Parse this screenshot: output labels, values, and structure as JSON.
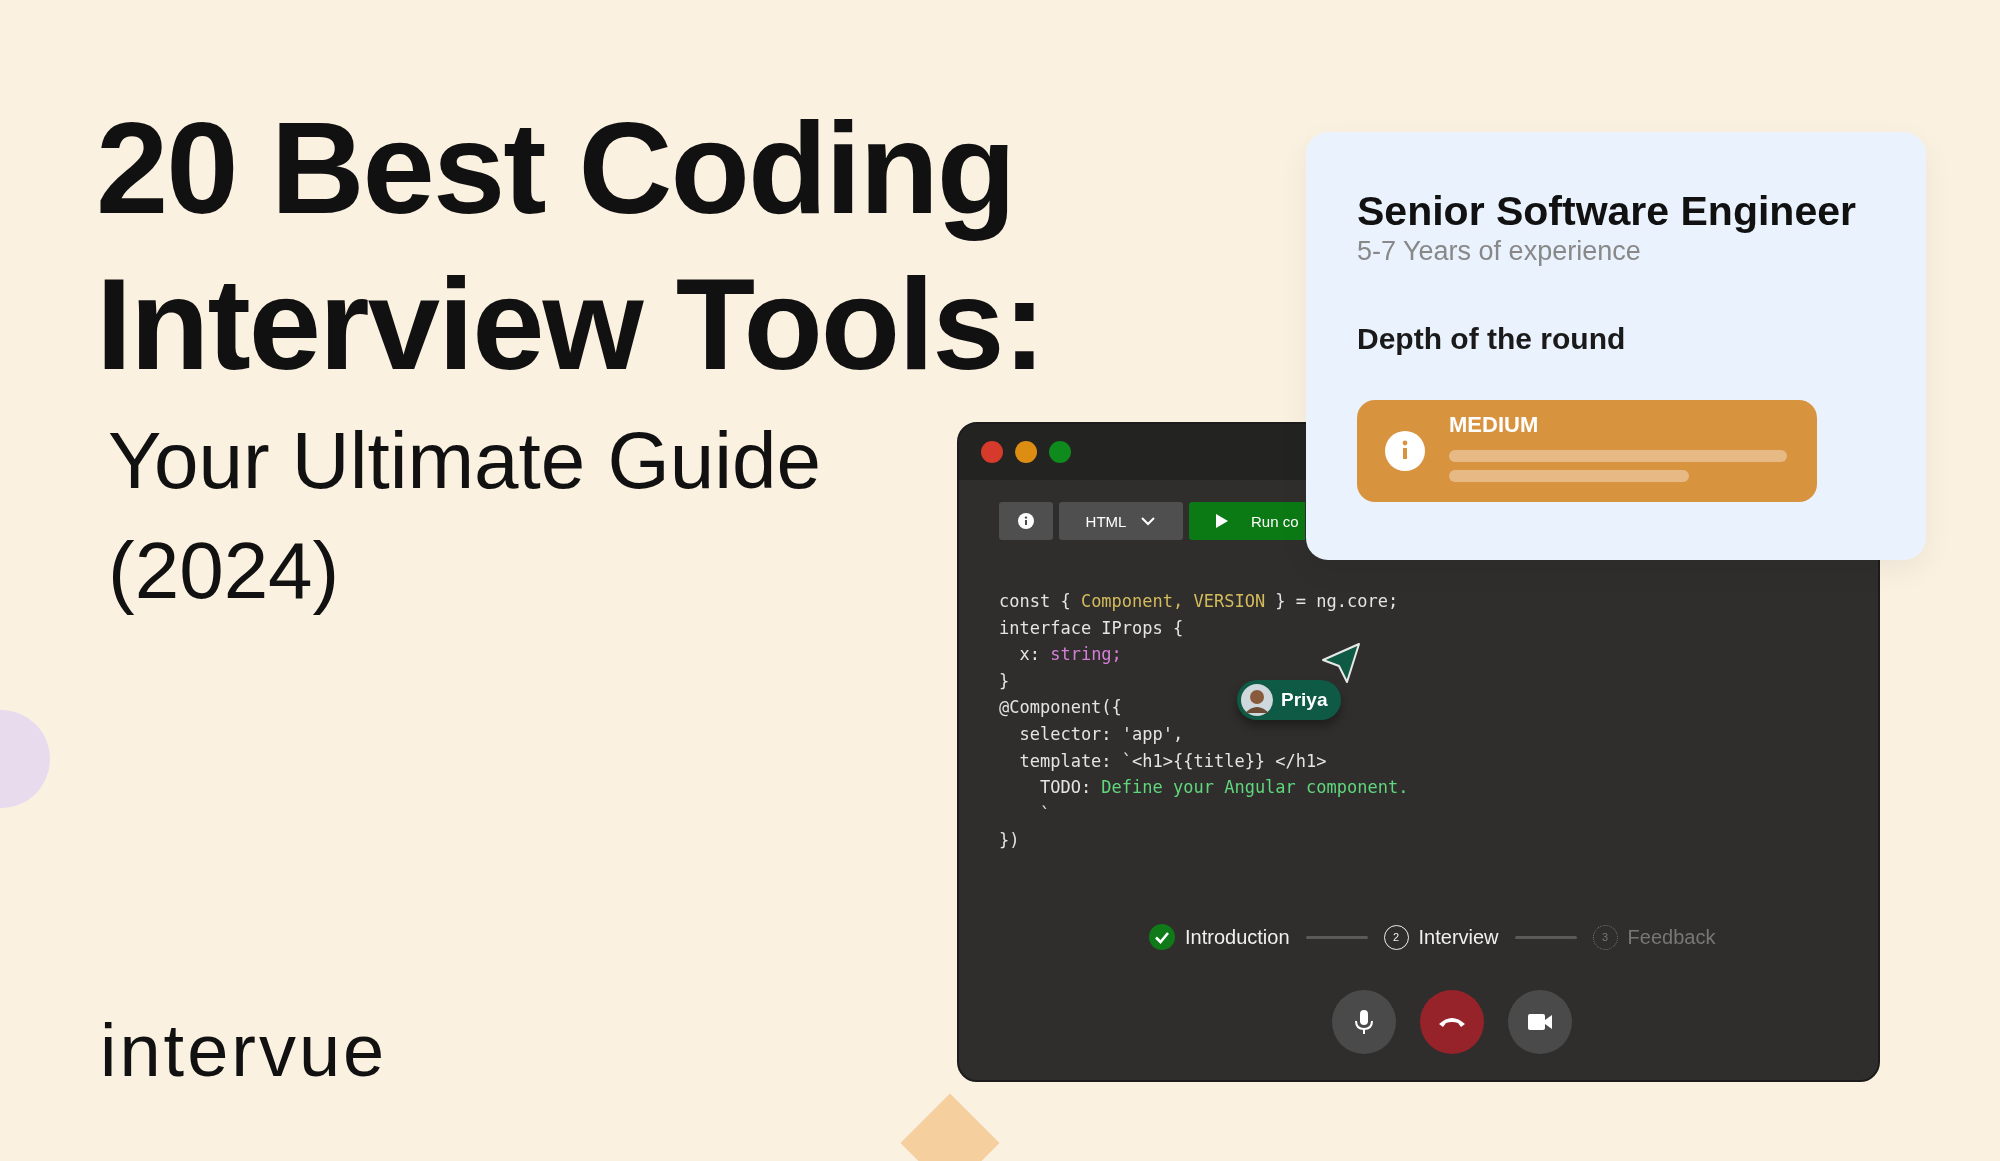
{
  "headline": {
    "title_lines": [
      "20 Best Coding",
      "Interview Tools:"
    ],
    "subtitle_lines": [
      "Your Ultimate Guide",
      "(2024)"
    ]
  },
  "logo": {
    "text": "intervue"
  },
  "editor": {
    "toolbar": [
      {
        "kind": "info"
      },
      {
        "kind": "dropdown",
        "label": "HTML"
      },
      {
        "kind": "run",
        "label": "Run co"
      }
    ],
    "code_lines": [
      [
        {
          "kind": "plain",
          "text": "const { "
        },
        {
          "kind": "type",
          "text": "Component, VERSION"
        },
        {
          "kind": "plain",
          "text": " } = ng.core;"
        }
      ],
      [
        {
          "kind": "plain",
          "text": "interface IProps {"
        }
      ],
      [
        {
          "kind": "plain",
          "text": "  x: "
        },
        {
          "kind": "string",
          "text": "string;"
        }
      ],
      [
        {
          "kind": "plain",
          "text": "}"
        }
      ],
      [
        {
          "kind": "plain",
          "text": "@Component({"
        }
      ],
      [
        {
          "kind": "plain",
          "text": "  selector: 'app',"
        }
      ],
      [
        {
          "kind": "plain",
          "text": "  template: `<h1>{{title}} </h1>"
        }
      ],
      [
        {
          "kind": "plain",
          "text": "    TODO: "
        },
        {
          "kind": "comment",
          "text": "Define your Angular component."
        }
      ],
      [
        {
          "kind": "plain",
          "text": "    `"
        }
      ],
      [
        {
          "kind": "plain",
          "text": "})"
        }
      ]
    ],
    "collaborator": {
      "name": "Priya"
    },
    "steps": [
      {
        "label": "Introduction",
        "completed": true,
        "active": false
      },
      {
        "label": "Interview",
        "number": "2",
        "completed": false,
        "active": true
      },
      {
        "label": "Feedback",
        "number": "3",
        "completed": false,
        "active": false
      }
    ],
    "call_controls": [
      {
        "kind": "mic"
      },
      {
        "kind": "hangup"
      },
      {
        "kind": "camera"
      }
    ]
  },
  "job_card": {
    "title": "Senior Software Engineer",
    "experience": "5-7 Years of experience",
    "depth_label": "Depth of the round",
    "depth_level": "MEDIUM"
  }
}
